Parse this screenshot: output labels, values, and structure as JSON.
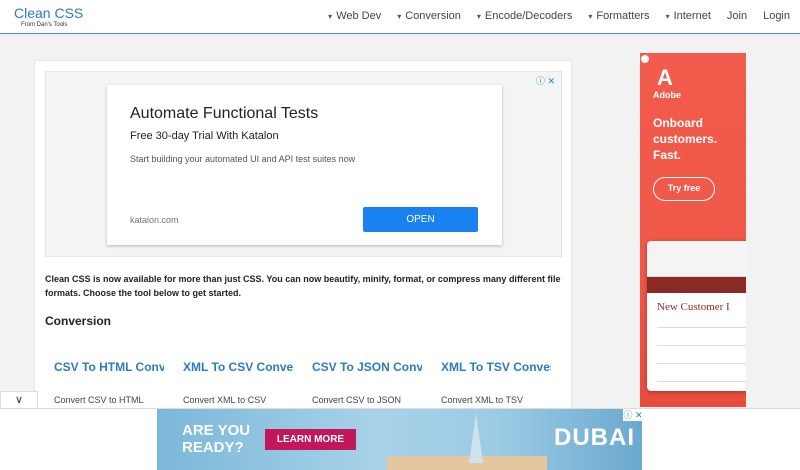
{
  "header": {
    "logo_title": "Clean CSS",
    "logo_sub": "From Dan's Tools",
    "nav": [
      {
        "label": "Web Dev",
        "has_dropdown": true
      },
      {
        "label": "Conversion",
        "has_dropdown": true
      },
      {
        "label": "Encode/Decoders",
        "has_dropdown": true
      },
      {
        "label": "Formatters",
        "has_dropdown": true
      },
      {
        "label": "Internet",
        "has_dropdown": true
      },
      {
        "label": "Join",
        "has_dropdown": false
      },
      {
        "label": "Login",
        "has_dropdown": false
      }
    ]
  },
  "ad": {
    "title": "Automate Functional Tests",
    "subtitle": "Free 30-day Trial With Katalon",
    "description": "Start building your automated UI and API test suites now",
    "domain": "katalon.com",
    "button": "OPEN"
  },
  "main": {
    "intro": "Clean CSS is now available for more than just CSS. You can now beautify, minify, format, or compress many different file formats. Choose the tool below to get started.",
    "section_title": "Conversion",
    "tools": [
      {
        "title": "CSV To HTML Converter",
        "desc": "Convert CSV to HTML"
      },
      {
        "title": "XML To CSV Converter",
        "desc": "Convert XML to CSV"
      },
      {
        "title": "CSV To JSON Converter",
        "desc": "Convert CSV to JSON"
      },
      {
        "title": "XML To TSV Converter",
        "desc": "Convert XML to TSV"
      }
    ]
  },
  "side_ad": {
    "brand": "Adobe",
    "headline": "Onboard customers. Fast.",
    "button": "Try free",
    "screenshot_title": "New Customer I"
  },
  "bottom_ad": {
    "tagline": "ARE YOU READY?",
    "button": "LEARN MORE",
    "brand": "DUBAI"
  },
  "colors": {
    "accent": "#2b7bc0",
    "ad_button": "#1a82f0",
    "adobe_red": "#f0584a",
    "learn_more": "#c2185b"
  }
}
